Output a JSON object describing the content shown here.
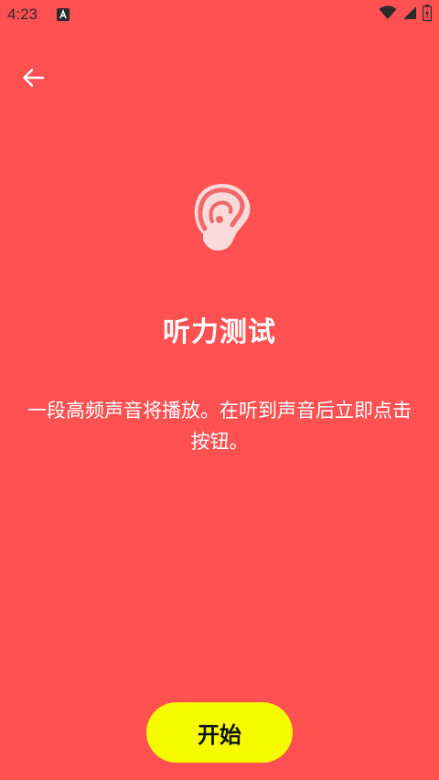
{
  "status_bar": {
    "time": "4:23",
    "icons": [
      "app-notification-icon",
      "wifi-icon",
      "signal-icon",
      "battery-icon"
    ]
  },
  "header": {
    "back_icon": "arrow-left-icon"
  },
  "main": {
    "icon": "ear-icon",
    "title": "听力测试",
    "description": "一段高频声音将播放。在听到声音后立即点击按钮。"
  },
  "actions": {
    "start_label": "开始"
  },
  "colors": {
    "background": "#ff5052",
    "primary_button": "#f6fb00",
    "text": "#ffffff",
    "button_text": "#111111"
  }
}
